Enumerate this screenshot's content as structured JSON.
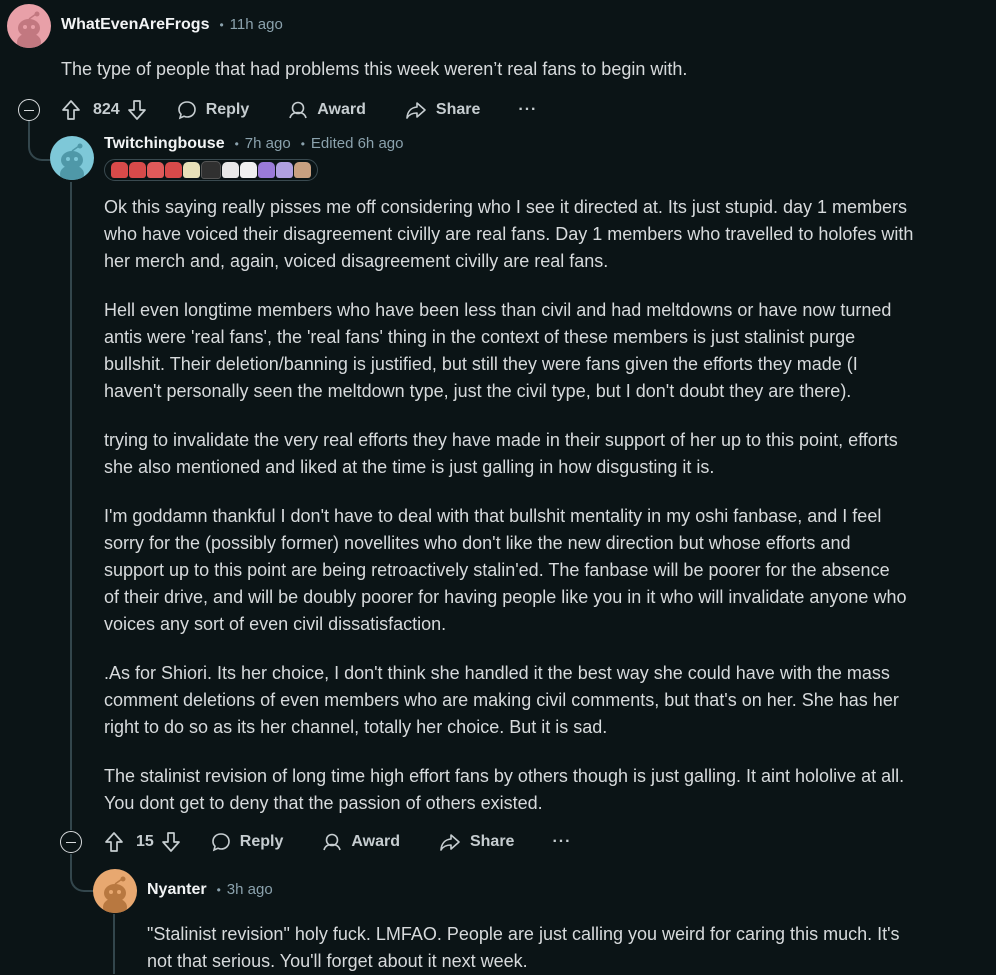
{
  "comments": [
    {
      "username": "WhatEvenAreFrogs",
      "time": "11h ago",
      "avatar_color": "#e8a0a8",
      "paragraphs": [
        "The type of people that had problems this week weren’t real fans to begin with."
      ],
      "votes": "824"
    },
    {
      "username": "Twitchingbouse",
      "time": "7h ago",
      "edited": "Edited 6h ago",
      "avatar_color": "#7ec8d8",
      "flair_colors": [
        "#d84a4a",
        "#d84a4a",
        "#e05a5a",
        "#d84a4a",
        "#e8e0b8",
        "#303030",
        "#e8e8e8",
        "#f0f0f0",
        "#9a7ad8",
        "#b0a0e0",
        "#c8a080"
      ],
      "paragraphs": [
        [
          "Ok this saying really pisses me off considering who I see it directed at. Its just stupid. day 1 members",
          "who have voiced their disagreement civilly are real fans. Day 1 members who travelled to holofes with",
          "her merch and, again, voiced disagreement civilly are real fans."
        ],
        [
          "Hell even longtime members who have been less than civil and had meltdowns or have now turned",
          "antis were 'real fans', the 'real fans' thing in the context of these members is just stalinist purge",
          "bullshit. Their deletion/banning is justified, but still they were fans given the efforts they made (I",
          "haven't personally seen the meltdown type, just the civil type, but I don't doubt they are there)."
        ],
        [
          "trying to invalidate the very real efforts they have made in their support of her up to this point, efforts",
          "she also mentioned and liked at the time is just galling in how disgusting it is."
        ],
        [
          "I'm goddamn thankful I don't have to deal with that bullshit mentality in my oshi fanbase, and I feel",
          "sorry for the (possibly former) novellites who don't like the new direction but whose efforts and",
          "support up to this point are being retroactively stalin'ed. The fanbase will be poorer for the absence",
          "of their drive, and will be doubly poorer for having people like you in it who will invalidate anyone who",
          "voices any sort of even civil dissatisfaction."
        ],
        [
          ".As for Shiori. Its her choice, I don't think she handled it the best way she could have with the mass",
          "comment deletions of even members who are making civil comments, but that's on her. She has her",
          "right to do so as its her channel, totally her choice. But it is sad."
        ],
        [
          "The stalinist revision of long time high effort fans by others though is just galling. It aint hololive at all.",
          "You dont get to deny that the passion of others existed."
        ]
      ],
      "votes": "15"
    },
    {
      "username": "Nyanter",
      "time": "3h ago",
      "avatar_color": "#e8a870",
      "paragraphs": [
        [
          "\"Stalinist revision\" holy fuck. LMFAO. People are just calling you weird for caring this much. It's",
          "not that serious. You'll forget about it next week."
        ]
      ]
    }
  ],
  "actions": {
    "reply": "Reply",
    "award": "Award",
    "share": "Share",
    "more": "···"
  },
  "icons": {
    "upvote": "arrow-up-icon",
    "downvote": "arrow-down-icon",
    "reply": "speech-bubble-icon",
    "award": "award-icon",
    "share": "share-arrow-icon",
    "collapse": "collapse-minus-icon"
  }
}
